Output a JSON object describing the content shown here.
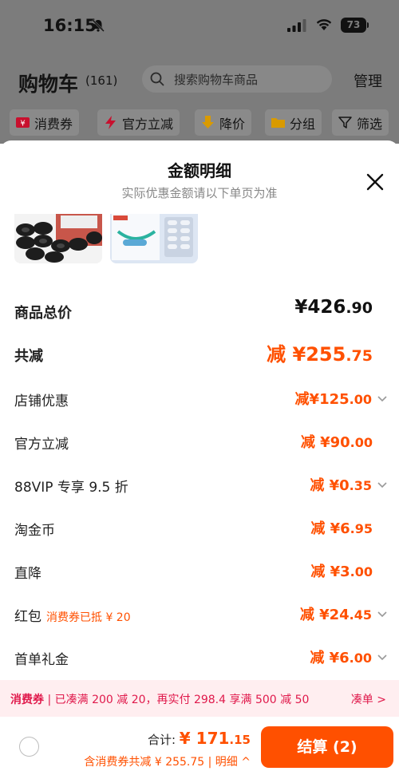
{
  "status_bar": {
    "time": "16:15",
    "battery": "73"
  },
  "header": {
    "title": "购物车",
    "count": "(161)",
    "search_placeholder": "搜索购物车商品",
    "manage": "管理"
  },
  "chips": [
    {
      "label": "消费券",
      "icon": "coupon-icon"
    },
    {
      "label": "官方立减",
      "icon": "lightning-icon"
    },
    {
      "label": "降价",
      "icon": "arrow-down-icon"
    },
    {
      "label": "分组",
      "icon": "folder-icon"
    },
    {
      "label": "筛选",
      "icon": "filter-icon"
    }
  ],
  "sheet": {
    "title": "金额明细",
    "subtitle": "实际优惠金额请以下单页为准",
    "rows": [
      {
        "label": "商品总价",
        "value_main": "¥426",
        "value_dec": ".90"
      },
      {
        "label": "共减",
        "value_main": "减 ¥255",
        "value_dec": ".75"
      },
      {
        "label": "店铺优惠",
        "value_main": "减¥125",
        "value_dec": ".00"
      },
      {
        "label": "官方立减",
        "value_main": "减 ¥90",
        "value_dec": ".00"
      },
      {
        "label": "88VIP 专享 9.5 折",
        "value_main": "减 ¥0",
        "value_dec": ".35"
      },
      {
        "label": "淘金币",
        "value_main": "减 ¥6",
        "value_dec": ".95"
      },
      {
        "label": "直降",
        "value_main": "减 ¥3",
        "value_dec": ".00"
      },
      {
        "label": "红包",
        "note": "消费券已抵 ¥ 20",
        "value_main": "减 ¥24",
        "value_dec": ".45"
      },
      {
        "label": "首单礼金",
        "value_main": "减 ¥6",
        "value_dec": ".00"
      }
    ]
  },
  "coupon_bar": {
    "tag": "消费券",
    "sep": "|",
    "text": "已凑满 200 减 20，再实付 298.4 享满 500 减 50",
    "link": "凑单 >"
  },
  "checkout": {
    "total_label": "合计: ",
    "total_main": "¥ 171",
    "total_dec": ".15",
    "discount": "含消费券共减 ¥ 255.75",
    "detail_link": "| 明细 ^",
    "button": "结算 (2)"
  },
  "colors": {
    "accent": "#ff5000",
    "coupon_red": "#e0194b",
    "overlay": "#7c7c7c"
  }
}
